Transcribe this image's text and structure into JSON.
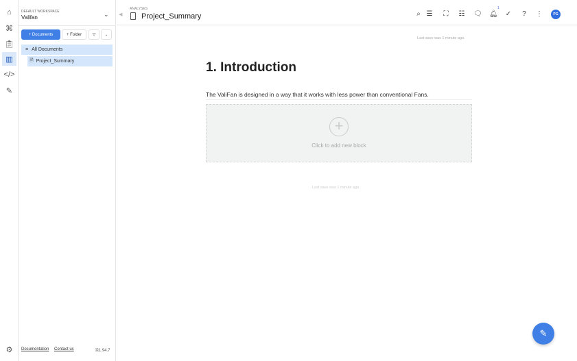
{
  "workspace": {
    "label": "DEFAULT WORKSPACE",
    "name": "Valifan"
  },
  "sidebar": {
    "new_documents": "+ Documents",
    "new_folder": "+ Folder",
    "tree": [
      {
        "label": "All Documents"
      },
      {
        "label": "Project_Summary"
      }
    ]
  },
  "footer": {
    "documentation": "Documentation",
    "contact": "Contact us",
    "version": "1.94.7"
  },
  "header": {
    "breadcrumb": "ANALYSES",
    "title": "Project_Summary",
    "notification_count": "1",
    "avatar_initials": "PG"
  },
  "document": {
    "last_save_top": "Last save was 1 minute ago.",
    "heading": "1. Introduction",
    "paragraph": "The ValiFan is designed in a way that it works with less power than conventional Fans.",
    "add_block_label": "Click to add new block",
    "last_save_bottom": "Last save was 1 minute ago."
  }
}
